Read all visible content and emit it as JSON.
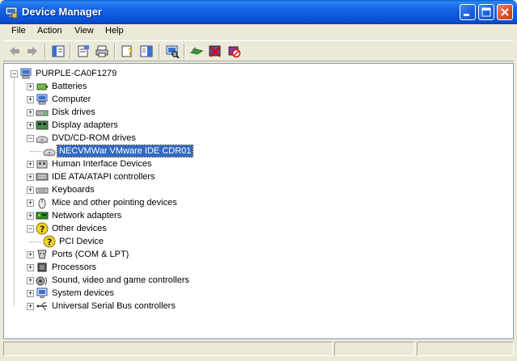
{
  "window": {
    "title": "Device Manager"
  },
  "menu": [
    {
      "label": "File"
    },
    {
      "label": "Action"
    },
    {
      "label": "View"
    },
    {
      "label": "Help"
    }
  ],
  "toolbar": {
    "buttons": [
      {
        "icon": "back-arrow-icon"
      },
      {
        "icon": "forward-arrow-icon"
      },
      {
        "icon": "show-hide-console-tree-icon"
      },
      {
        "icon": "properties-icon"
      },
      {
        "icon": "print-icon"
      },
      {
        "icon": "help-icon"
      },
      {
        "icon": "show-hide-action-pane-icon"
      },
      {
        "icon": "scan-hardware-changes-icon"
      },
      {
        "icon": "update-driver-icon"
      },
      {
        "icon": "uninstall-icon"
      },
      {
        "icon": "disable-device-icon"
      }
    ]
  },
  "tree": {
    "root": {
      "label": "PURPLE-CA0F1279",
      "icon": "computer-icon"
    },
    "items": [
      {
        "label": "Batteries",
        "icon": "battery-icon",
        "expanded": false,
        "children": []
      },
      {
        "label": "Computer",
        "icon": "computer-icon",
        "expanded": false,
        "children": []
      },
      {
        "label": "Disk drives",
        "icon": "disk-drive-icon",
        "expanded": false,
        "children": []
      },
      {
        "label": "Display adapters",
        "icon": "display-adapter-icon",
        "expanded": false,
        "children": []
      },
      {
        "label": "DVD/CD-ROM drives",
        "icon": "cdrom-icon",
        "expanded": true,
        "children": [
          {
            "label": "NECVMWar VMware IDE CDR01",
            "icon": "cdrom-icon",
            "selected": true
          }
        ]
      },
      {
        "label": "Human Interface Devices",
        "icon": "hid-icon",
        "expanded": false,
        "children": []
      },
      {
        "label": "IDE ATA/ATAPI controllers",
        "icon": "ide-controller-icon",
        "expanded": false,
        "children": []
      },
      {
        "label": "Keyboards",
        "icon": "keyboard-icon",
        "expanded": false,
        "children": []
      },
      {
        "label": "Mice and other pointing devices",
        "icon": "mouse-icon",
        "expanded": false,
        "children": []
      },
      {
        "label": "Network adapters",
        "icon": "network-adapter-icon",
        "expanded": false,
        "children": []
      },
      {
        "label": "Other devices",
        "icon": "unknown-device-icon",
        "expanded": true,
        "children": [
          {
            "label": "PCI Device",
            "icon": "unknown-device-icon",
            "selected": false
          }
        ]
      },
      {
        "label": "Ports (COM & LPT)",
        "icon": "port-icon",
        "expanded": false,
        "children": []
      },
      {
        "label": "Processors",
        "icon": "processor-icon",
        "expanded": false,
        "children": []
      },
      {
        "label": "Sound, video and game controllers",
        "icon": "sound-icon",
        "expanded": false,
        "children": []
      },
      {
        "label": "System devices",
        "icon": "system-device-icon",
        "expanded": false,
        "children": []
      },
      {
        "label": "Universal Serial Bus controllers",
        "icon": "usb-icon",
        "expanded": false,
        "children": []
      }
    ]
  },
  "colors": {
    "titlebar": "#0a5fd8",
    "selection": "#316ac5",
    "window_face": "#ece9d8"
  }
}
